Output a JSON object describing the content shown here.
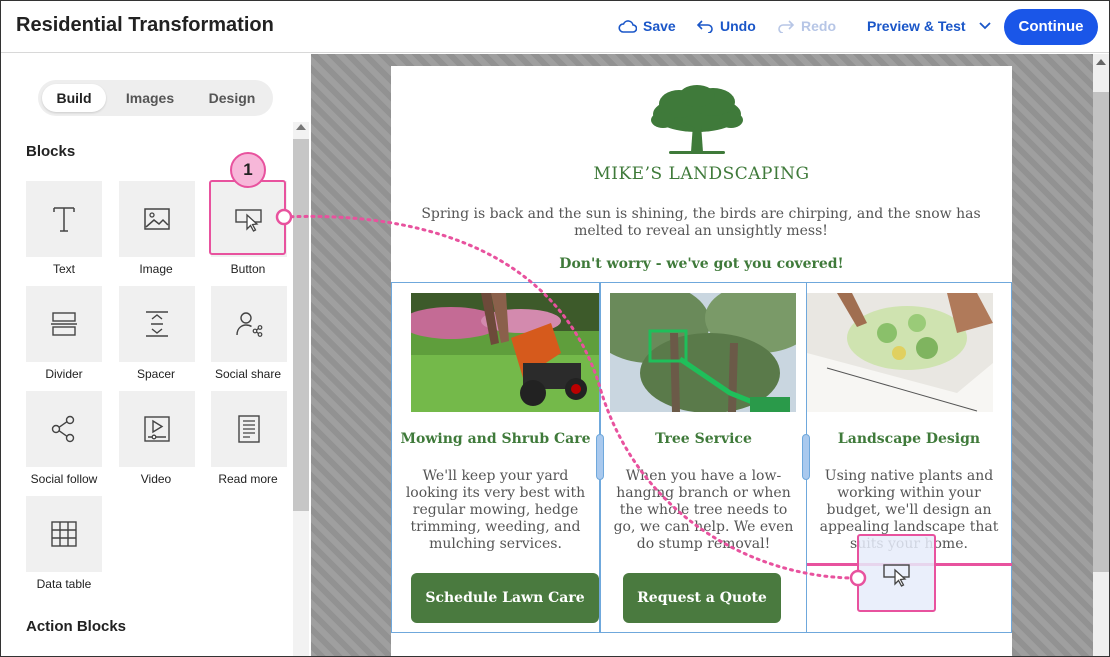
{
  "header": {
    "title": "Residential Transformation",
    "save": "Save",
    "undo": "Undo",
    "redo": "Redo",
    "preview": "Preview & Test",
    "continue": "Continue"
  },
  "sidebar": {
    "tabs": [
      "Build",
      "Images",
      "Design"
    ],
    "blocks_title": "Blocks",
    "blocks": [
      "Text",
      "Image",
      "Button",
      "Divider",
      "Spacer",
      "Social share",
      "Social follow",
      "Video",
      "Read more",
      "Data table"
    ],
    "action_blocks_title": "Action Blocks",
    "step_badge": "1"
  },
  "email": {
    "brand": "MIKE’S LANDSCAPING",
    "intro": "Spring is back and the sun is shining, the birds are chirping, and the snow has melted to reveal an unsightly mess!",
    "tagline": "Don't worry - we've got you covered!",
    "columns": [
      {
        "title": "Mowing and Shrub Care",
        "text": "We'll keep your yard looking its very best with regular mowing, hedge trimming, weeding, and mulching services.",
        "cta": "Schedule Lawn Care"
      },
      {
        "title": "Tree Service",
        "text": "When you have a low-hanging branch or when the whole tree needs to go, we can help. We even do stump removal!",
        "cta": "Request a Quote"
      },
      {
        "title": "Landscape Design",
        "text": "Using native plants and working within your budget, we'll design an appealing landscape that suits your home."
      }
    ]
  },
  "colors": {
    "accent": "#1a56e8",
    "brand_green": "#3f7a3a",
    "button_green": "#4a7a3f",
    "highlight_pink": "#e8529e",
    "column_border": "#6fa8dc"
  },
  "icons": [
    "cloud-save-icon",
    "undo-icon",
    "redo-icon",
    "chevron-down-icon",
    "text-block-icon",
    "image-block-icon",
    "button-block-icon",
    "divider-block-icon",
    "spacer-block-icon",
    "social-share-icon",
    "social-follow-icon",
    "video-block-icon",
    "read-more-icon",
    "data-table-icon",
    "tree-logo-icon"
  ]
}
